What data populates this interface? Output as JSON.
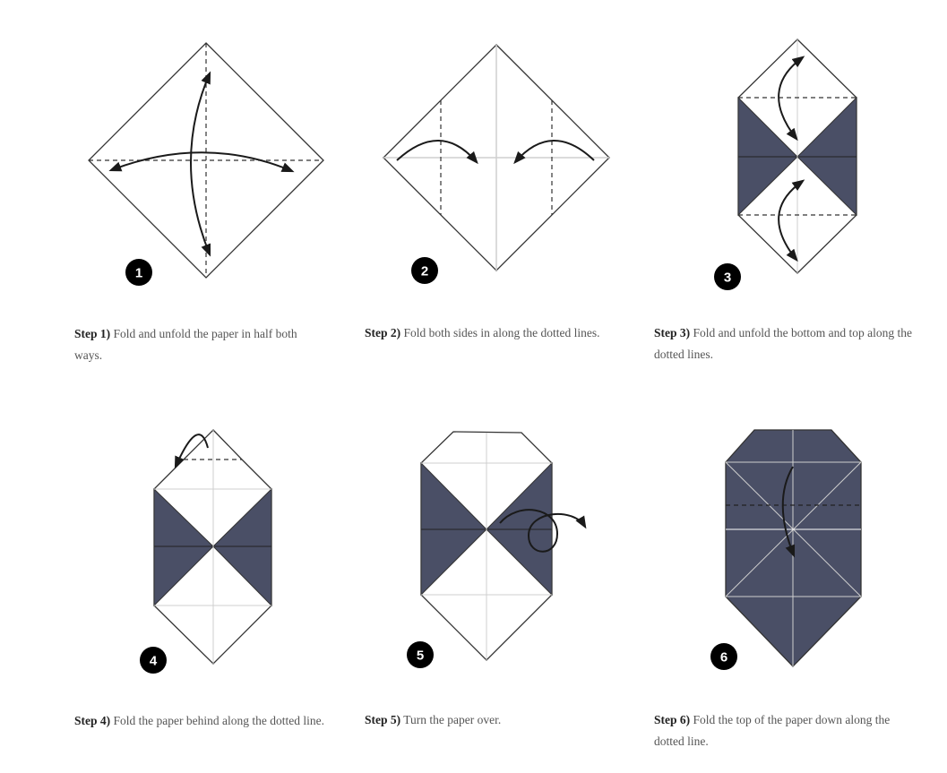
{
  "colors": {
    "navy": "#4a4f66",
    "ink": "#1a1a1a",
    "guide": "#cfcfcf",
    "caption_text": "#555555"
  },
  "steps": [
    {
      "number": "1",
      "label": "Step 1)",
      "text": " Fold and unfold the paper in half both ways."
    },
    {
      "number": "2",
      "label": "Step 2)",
      "text": " Fold both sides in along the dotted lines."
    },
    {
      "number": "3",
      "label": "Step 3)",
      "text": " Fold and unfold the bottom and top along the dotted lines."
    },
    {
      "number": "4",
      "label": "Step 4)",
      "text": " Fold the paper behind along the dotted line."
    },
    {
      "number": "5",
      "label": "Step 5)",
      "text": " Turn the paper over."
    },
    {
      "number": "6",
      "label": "Step 6)",
      "text": " Fold the top of the paper down along the dotted line."
    }
  ]
}
